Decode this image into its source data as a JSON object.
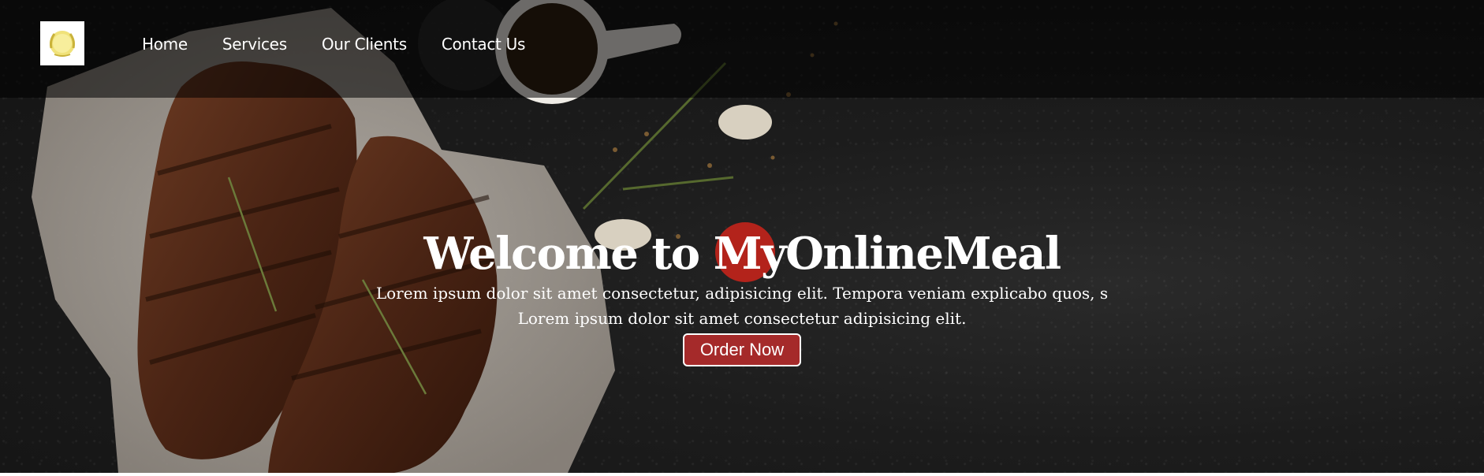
{
  "nav": {
    "logo_icon": "laurel-wreath-icon",
    "links": [
      {
        "label": "Home"
      },
      {
        "label": "Services"
      },
      {
        "label": "Our Clients"
      },
      {
        "label": "Contact Us"
      }
    ]
  },
  "hero": {
    "title": "Welcome to MyOnlineMeal",
    "text_line1": "Lorem ipsum dolor sit amet consectetur, adipisicing elit. Tempora veniam explicabo quos, s",
    "text_line2": "Lorem ipsum dolor sit amet consectetur adipisicing elit.",
    "button_label": "Order Now"
  },
  "colors": {
    "button_bg": "#a52a2a",
    "navbar_bg": "rgba(0,0,0,0.55)",
    "hero_bg": "#1c1c1c"
  }
}
